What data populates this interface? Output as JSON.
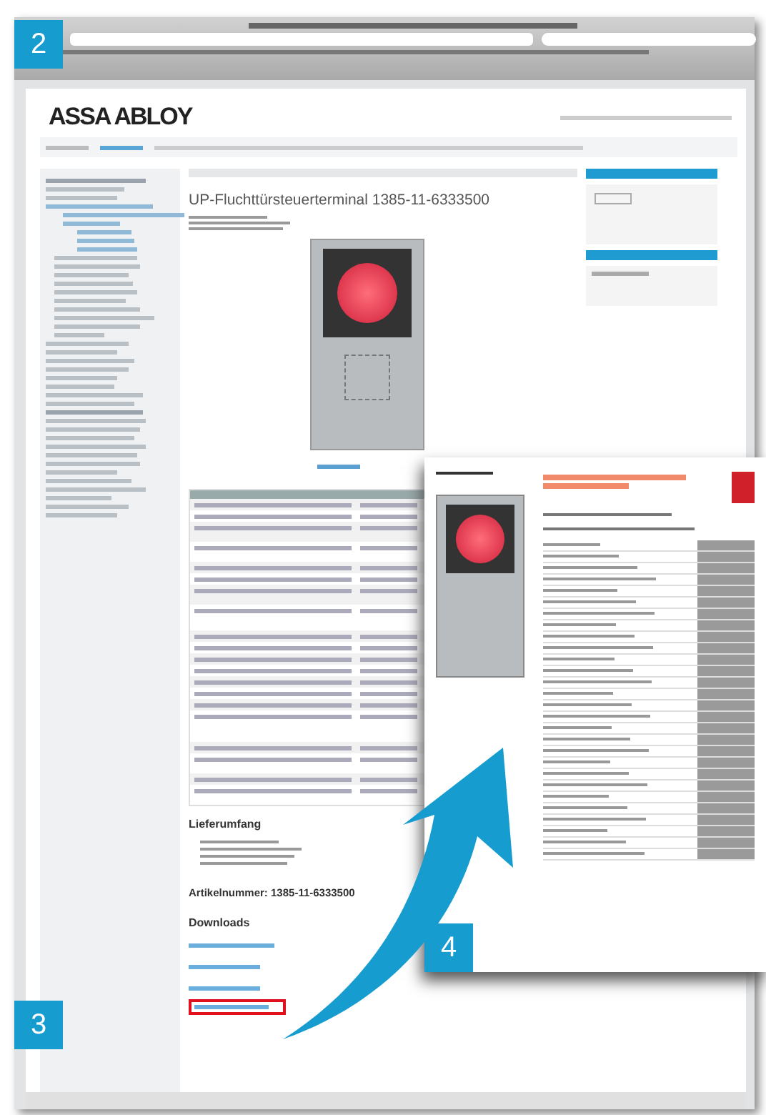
{
  "markers": [
    {
      "label": "2"
    },
    {
      "label": "3"
    },
    {
      "label": "4"
    }
  ],
  "site": {
    "logo": "ASSA ABLOY"
  },
  "product": {
    "title": "UP-Fluchttürsteuerterminal 1385-11-6333500"
  },
  "delivery": {
    "heading": "Lieferumfang"
  },
  "article": {
    "number": "Artikelnummer: 1385-11-6333500"
  },
  "downloads": {
    "heading": "Downloads"
  }
}
